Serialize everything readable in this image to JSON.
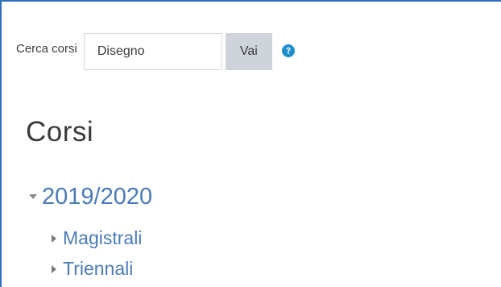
{
  "search": {
    "label": "Cerca corsi",
    "value": "Disegno",
    "button_label": "Vai",
    "help_icon": "question-circle-icon"
  },
  "page": {
    "title": "Corsi"
  },
  "categories": [
    {
      "label": "2019/2020",
      "expanded": true,
      "icon": "caret-down-icon"
    },
    {
      "label": "Magistrali",
      "expanded": false,
      "icon": "caret-right-icon"
    },
    {
      "label": "Triennali",
      "expanded": false,
      "icon": "caret-right-icon"
    }
  ],
  "colors": {
    "accent": "#2f6fbf",
    "link": "#4a7bb7",
    "button_bg": "#ced4da",
    "help_icon": "#1f8ece"
  }
}
